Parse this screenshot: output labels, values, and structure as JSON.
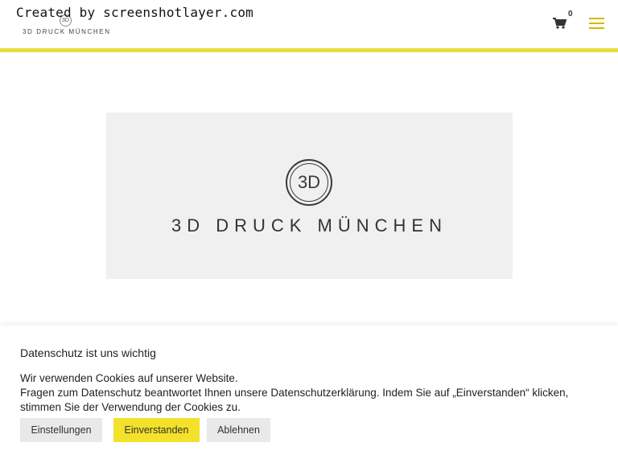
{
  "watermark": "Created by screenshotlayer.com",
  "header": {
    "logo_mark": "3D",
    "logo_text": "3D DRUCK MÜNCHEN",
    "cart_icon": "shopping-cart-icon",
    "cart_count": "0",
    "menu_icon": "hamburger-menu-icon",
    "accent_color": "#e6dd3b"
  },
  "hero": {
    "logo_mark": "3D",
    "brand": "3D DRUCK MÜNCHEN"
  },
  "cookie_banner": {
    "title": "Datenschutz ist uns wichtig",
    "line1": "Wir verwenden Cookies auf unserer Website.",
    "line2": "Fragen zum Datenschutz beantwortet Ihnen unsere Datenschutzerklärung. Indem Sie auf „Einverstanden“ klicken, stimmen Sie der Verwendung der Cookies zu.",
    "settings_label": "Einstellungen",
    "accept_label": "Einverstanden",
    "reject_label": "Ablehnen",
    "accept_color": "#f3e12b"
  }
}
